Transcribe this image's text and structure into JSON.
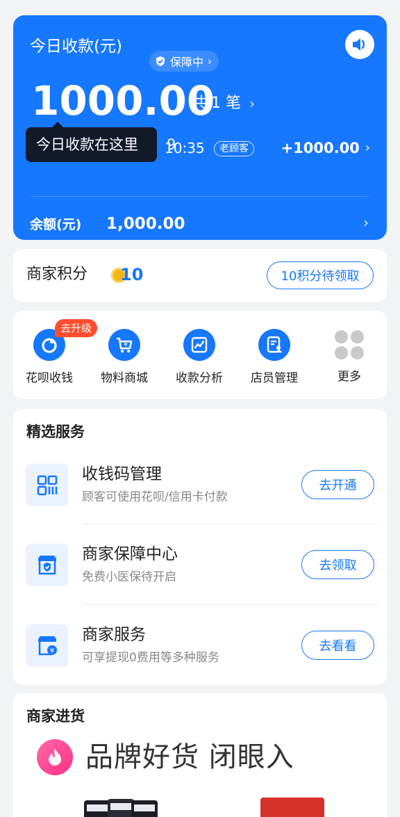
{
  "hero": {
    "title": "今日收款(元)",
    "guarantee_label": "保障中",
    "amount": "1000.00",
    "count_label": "共 1 笔",
    "tooltip": "今日收款在这里",
    "tooltip_peek": "9",
    "tx_time": "10:35",
    "tx_badge": "老顾客",
    "tx_amount": "+1000.00",
    "balance_label": "余额(元)",
    "balance_value": "1,000.00"
  },
  "points": {
    "label": "商家积分",
    "value": "10",
    "claim_button": "10积分待领取"
  },
  "quick": {
    "upgrade_badge": "去升级",
    "items": [
      {
        "label": "花呗收钱",
        "icon": "huabei-icon"
      },
      {
        "label": "物料商城",
        "icon": "cart-icon"
      },
      {
        "label": "收款分析",
        "icon": "chart-icon"
      },
      {
        "label": "店员管理",
        "icon": "staff-icon"
      },
      {
        "label": "更多",
        "icon": "more-icon"
      }
    ]
  },
  "services": {
    "title": "精选服务",
    "items": [
      {
        "title": "收钱码管理",
        "subtitle": "顾客可使用花呗/信用卡付款",
        "button": "去开通",
        "icon": "qrcode-icon"
      },
      {
        "title": "商家保障中心",
        "subtitle": "免费小医保待开启",
        "button": "去领取",
        "icon": "shop-shield-icon"
      },
      {
        "title": "商家服务",
        "subtitle": "可享提现0费用等多种服务",
        "button": "去看看",
        "icon": "shop-yuan-icon"
      }
    ]
  },
  "purchasing": {
    "title": "商家进货",
    "banner_text": "品牌好货 闭眼入"
  },
  "colors": {
    "primary": "#1677ff",
    "upgrade_badge": "#ff4d2e",
    "tooltip_bg": "#121a2a",
    "coin": "#f5b619"
  }
}
